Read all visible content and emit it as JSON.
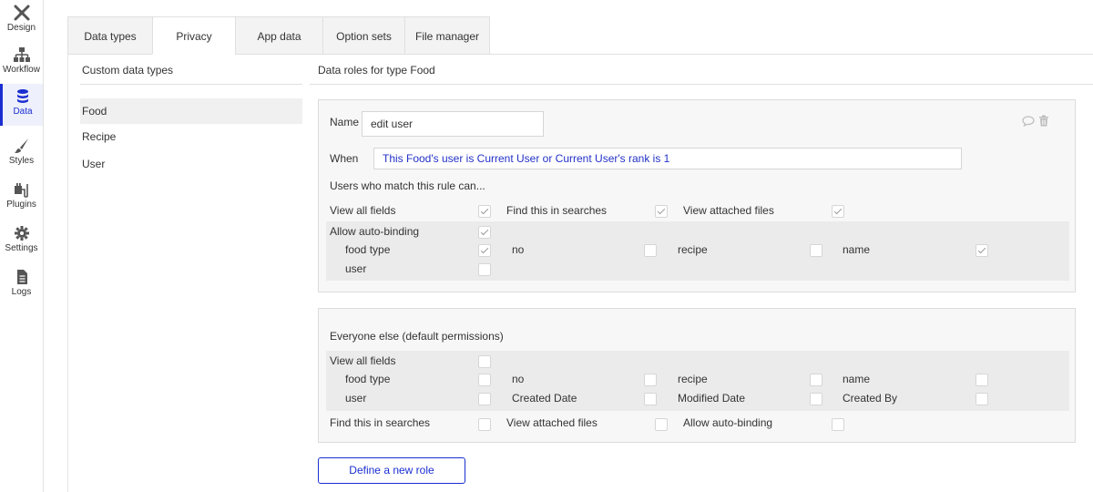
{
  "rail": {
    "items": [
      {
        "label": "Design",
        "icon": "design-tools-icon"
      },
      {
        "label": "Workflow",
        "icon": "workflow-sitemap-icon"
      },
      {
        "label": "Data",
        "icon": "database-icon"
      },
      {
        "label": "Styles",
        "icon": "brush-icon"
      },
      {
        "label": "Plugins",
        "icon": "plug-icon"
      },
      {
        "label": "Settings",
        "icon": "gear-icon"
      },
      {
        "label": "Logs",
        "icon": "document-icon"
      }
    ],
    "active": "Data",
    "accent": "#1a2fd0"
  },
  "tabs": [
    {
      "label": "Data types"
    },
    {
      "label": "Privacy"
    },
    {
      "label": "App data"
    },
    {
      "label": "Option sets"
    },
    {
      "label": "File manager"
    }
  ],
  "active_tab": "Privacy",
  "left": {
    "title": "Custom data types",
    "types": [
      {
        "label": "Food"
      },
      {
        "label": "Recipe"
      },
      {
        "label": "User"
      }
    ],
    "selected": "Food"
  },
  "right": {
    "title": "Data roles for type Food",
    "role": {
      "name_label": "Name",
      "name_value": "edit user",
      "when_label": "When",
      "when_value": "This Food's user is Current User or Current User's rank is 1",
      "users_rule_label": "Users who match this rule can...",
      "view_all_fields": {
        "label": "View all fields",
        "checked": true
      },
      "find_in_searches": {
        "label": "Find this in searches",
        "checked": true
      },
      "view_attached_files": {
        "label": "View attached files",
        "checked": true
      },
      "allow_auto_binding": {
        "label": "Allow auto-binding",
        "checked": true
      },
      "fields": [
        {
          "label": "food type",
          "checked": true
        },
        {
          "label": "no",
          "checked": false
        },
        {
          "label": "recipe",
          "checked": false
        },
        {
          "label": "name",
          "checked": true
        },
        {
          "label": "user",
          "checked": false
        }
      ]
    },
    "everyone": {
      "title": "Everyone else (default permissions)",
      "view_all_fields": {
        "label": "View all fields",
        "checked": false
      },
      "fields": [
        {
          "label": "food type",
          "checked": false
        },
        {
          "label": "no",
          "checked": false
        },
        {
          "label": "recipe",
          "checked": false
        },
        {
          "label": "name",
          "checked": false
        },
        {
          "label": "user",
          "checked": false
        },
        {
          "label": "Created Date",
          "checked": false
        },
        {
          "label": "Modified Date",
          "checked": false
        },
        {
          "label": "Created By",
          "checked": false
        }
      ],
      "find_in_searches": {
        "label": "Find this in searches",
        "checked": false
      },
      "view_attached_files": {
        "label": "View attached files",
        "checked": false
      },
      "allow_auto_binding": {
        "label": "Allow auto-binding",
        "checked": false
      }
    },
    "new_role_button": "Define a new role"
  }
}
